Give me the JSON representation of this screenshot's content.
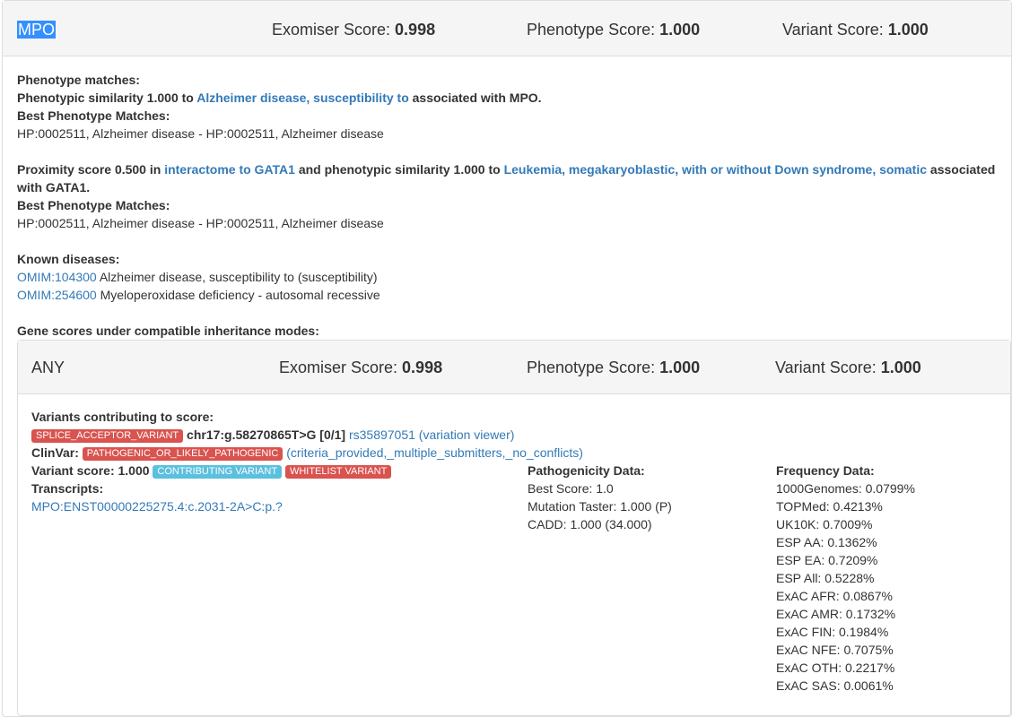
{
  "header": {
    "gene": "MPO",
    "exomiser_label": "Exomiser Score: ",
    "exomiser_value": "0.998",
    "phenotype_label": "Phenotype Score: ",
    "phenotype_value": "1.000",
    "variant_label": "Variant Score: ",
    "variant_value": "1.000"
  },
  "phenotype": {
    "title": "Phenotype matches:",
    "sim_prefix": "Phenotypic similarity 1.000 to ",
    "sim_link": "Alzheimer disease, susceptibility to",
    "sim_suffix": " associated with MPO.",
    "best_title": "Best Phenotype Matches:",
    "best_value": "HP:0002511, Alzheimer disease - HP:0002511, Alzheimer disease",
    "prox_prefix": "Proximity score 0.500 in ",
    "prox_link1": "interactome to GATA1",
    "prox_mid": " and phenotypic similarity 1.000 to ",
    "prox_link2": "Leukemia, megakaryoblastic, with or without Down syndrome, somatic",
    "prox_suffix": " associated",
    "prox_line2": "with GATA1.",
    "best_title2": "Best Phenotype Matches:",
    "best_value2": "HP:0002511, Alzheimer disease - HP:0002511, Alzheimer disease"
  },
  "known_diseases": {
    "title": "Known diseases:",
    "items": [
      {
        "link": "OMIM:104300",
        "text": " Alzheimer disease, susceptibility to (susceptibility)"
      },
      {
        "link": "OMIM:254600",
        "text": " Myeloperoxidase deficiency - autosomal recessive"
      }
    ]
  },
  "gene_scores": {
    "title": "Gene scores under compatible inheritance modes:",
    "mode": "ANY",
    "exomiser_label": "Exomiser Score: ",
    "exomiser_value": "0.998",
    "phenotype_label": "Phenotype Score: ",
    "phenotype_value": "1.000",
    "variant_label": "Variant Score: ",
    "variant_value": "1.000"
  },
  "variants": {
    "title": "Variants contributing to score:",
    "effect_badge": "SPLICE_ACCEPTOR_VARIANT",
    "hgvs": " chr17:g.58270865T>G [0/1] ",
    "rsid_link": "rs35897051 (variation viewer)",
    "clinvar_label": "ClinVar: ",
    "clinvar_badge": "PATHOGENIC_OR_LIKELY_PATHOGENIC",
    "clinvar_link": " (criteria_provided,_multiple_submitters,_no_conflicts)",
    "variant_score": "Variant score: 1.000",
    "contributing_badge": "CONTRIBUTING VARIANT",
    "whitelist_badge": "WHITELIST VARIANT",
    "transcripts_title": "Transcripts:",
    "transcript_link": "MPO:ENST00000225275.4:c.2031-2A>C:p.?"
  },
  "pathogenicity": {
    "title": "Pathogenicity Data:",
    "items": [
      "Best Score: 1.0",
      "Mutation Taster: 1.000 (P)",
      "CADD: 1.000 (34.000)"
    ]
  },
  "frequency": {
    "title": "Frequency Data:",
    "items": [
      "1000Genomes: 0.0799%",
      "TOPMed: 0.4213%",
      "UK10K: 0.7009%",
      "ESP AA: 0.1362%",
      "ESP EA: 0.7209%",
      "ESP All: 0.5228%",
      "ExAC AFR: 0.0867%",
      "ExAC AMR: 0.1732%",
      "ExAC FIN: 0.1984%",
      "ExAC NFE: 0.7075%",
      "ExAC OTH: 0.2217%",
      "ExAC SAS: 0.0061%"
    ]
  },
  "colors": {
    "link": "#337ab7",
    "danger": "#d9534f",
    "info": "#5bc0de",
    "selection": "#3390ff"
  }
}
